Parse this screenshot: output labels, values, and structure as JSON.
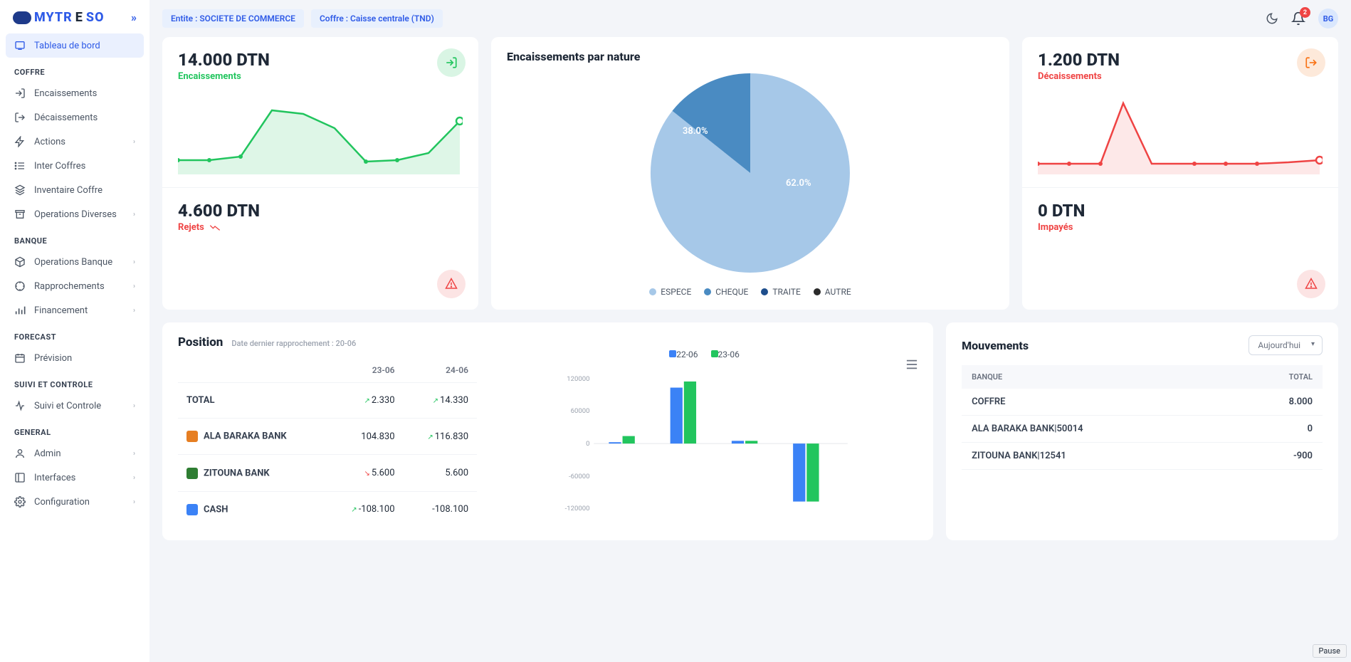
{
  "header": {
    "entity_pill": "Entite : SOCIETE DE COMMERCE",
    "coffre_pill": "Coffre : Caisse centrale (TND)",
    "notif_count": "2",
    "user_initials": "BG"
  },
  "sidebar": {
    "active": "Tableau de bord",
    "groups": [
      {
        "head": null,
        "items": [
          {
            "label": "Tableau de bord",
            "icon": "dashboard"
          }
        ]
      },
      {
        "head": "COFFRE",
        "items": [
          {
            "label": "Encaissements",
            "icon": "login"
          },
          {
            "label": "Décaissements",
            "icon": "logout"
          },
          {
            "label": "Actions",
            "icon": "bolt",
            "chev": true
          },
          {
            "label": "Inter Coffres",
            "icon": "list"
          },
          {
            "label": "Inventaire Coffre",
            "icon": "layers"
          },
          {
            "label": "Operations Diverses",
            "icon": "archive",
            "chev": true
          }
        ]
      },
      {
        "head": "BANQUE",
        "items": [
          {
            "label": "Operations Banque",
            "icon": "cube",
            "chev": true
          },
          {
            "label": "Rapprochements",
            "icon": "target",
            "chev": true
          },
          {
            "label": "Financement",
            "icon": "bars",
            "chev": true
          }
        ]
      },
      {
        "head": "FORECAST",
        "items": [
          {
            "label": "Prévision",
            "icon": "calendar"
          }
        ]
      },
      {
        "head": "SUIVI ET CONTROLE",
        "items": [
          {
            "label": "Suivi et Controle",
            "icon": "pulse",
            "chev": true
          }
        ]
      },
      {
        "head": "GENERAL",
        "items": [
          {
            "label": "Admin",
            "icon": "user",
            "chev": true
          },
          {
            "label": "Interfaces",
            "icon": "panel",
            "chev": true
          },
          {
            "label": "Configuration",
            "icon": "gear",
            "chev": true
          }
        ]
      }
    ]
  },
  "kpi": {
    "enc": {
      "value": "14.000 DTN",
      "label": "Encaissements"
    },
    "dec": {
      "value": "1.200 DTN",
      "label": "Décaissements"
    },
    "rej": {
      "value": "4.600 DTN",
      "label": "Rejets"
    },
    "imp": {
      "value": "0 DTN",
      "label": "Impayés"
    }
  },
  "pie": {
    "title": "Encaissements par nature",
    "legend": [
      "ESPECE",
      "CHEQUE",
      "TRAITE",
      "AUTRE"
    ]
  },
  "position": {
    "title": "Position",
    "sub": "Date dernier rapprochement : 20-06",
    "cols": [
      "",
      "23-06",
      "24-06"
    ],
    "rows": [
      {
        "name": "TOTAL",
        "c1": "2.330",
        "c1t": "up",
        "c2": "14.330",
        "c2t": "up",
        "ico": null
      },
      {
        "name": "ALA BARAKA BANK",
        "c1": "104.830",
        "c1t": null,
        "c2": "116.830",
        "c2t": "up",
        "ico": "#E67E22"
      },
      {
        "name": "ZITOUNA BANK",
        "c1": "5.600",
        "c1t": "dn",
        "c2": "5.600",
        "c2t": null,
        "ico": "#2E7D32"
      },
      {
        "name": "CASH",
        "c1": "-108.100",
        "c1t": "up",
        "c2": "-108.100",
        "c2t": null,
        "ico": "#3B82F6"
      }
    ],
    "bar_legend": [
      "22-06",
      "23-06"
    ]
  },
  "mouvements": {
    "title": "Mouvements",
    "filter": "Aujourd'hui",
    "cols": [
      "BANQUE",
      "TOTAL"
    ],
    "rows": [
      {
        "name": "COFFRE",
        "val": "8.000",
        "ico": "#3B82F6"
      },
      {
        "name": "ALA BARAKA BANK|50014",
        "val": "0",
        "ico": "#E67E22"
      },
      {
        "name": "ZITOUNA BANK|12541",
        "val": "-900",
        "ico": "#2E7D32"
      }
    ]
  },
  "pause": "Pause",
  "chart_data": [
    {
      "type": "area",
      "title": "Encaissements sparkline",
      "color": "#22C55E",
      "x": [
        0,
        1,
        2,
        3,
        4,
        5,
        6,
        7,
        8,
        9
      ],
      "values": [
        5,
        5,
        6,
        18,
        17,
        12,
        4,
        4,
        6,
        13
      ]
    },
    {
      "type": "area",
      "title": "Décaissements sparkline",
      "color": "#EF4444",
      "x": [
        0,
        1,
        2,
        3,
        4,
        5,
        6,
        7,
        8,
        9
      ],
      "values": [
        2,
        2,
        2,
        18,
        3,
        2,
        2,
        2,
        2,
        3
      ]
    },
    {
      "type": "pie",
      "title": "Encaissements par nature",
      "series": [
        {
          "name": "ESPECE",
          "value": 62.0,
          "color": "#A6C8E8"
        },
        {
          "name": "CHEQUE",
          "value": 38.0,
          "color": "#4A8BC2"
        },
        {
          "name": "TRAITE",
          "value": 0.0,
          "color": "#1E4E8C"
        },
        {
          "name": "AUTRE",
          "value": 0.0,
          "color": "#2B2B2B"
        }
      ]
    },
    {
      "type": "bar",
      "title": "Position par banque",
      "categories": [
        "TOTAL",
        "ALA BARAKA",
        "ZITOUNA",
        "CASH"
      ],
      "ylim": [
        -120000,
        120000
      ],
      "series": [
        {
          "name": "22-06",
          "color": "#3B82F6",
          "values": [
            2330,
            104830,
            5600,
            -108100
          ]
        },
        {
          "name": "23-06",
          "color": "#22C55E",
          "values": [
            14330,
            116830,
            5600,
            -108100
          ]
        }
      ]
    }
  ]
}
